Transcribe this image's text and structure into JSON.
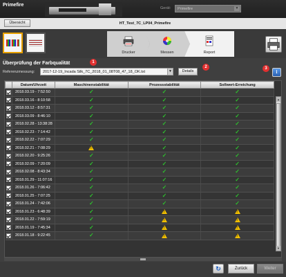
{
  "app": {
    "name": "Primefire"
  },
  "device": {
    "label": "Gerät:",
    "value": "Primefire"
  },
  "toolbar": {
    "overview_label": "Übersicht",
    "job_title": "HT_Test_7C_LP04_Primefire"
  },
  "steps": [
    {
      "label": "Drucker",
      "icon": "printer-icon"
    },
    {
      "label": "Messen",
      "icon": "color-wheel-icon"
    },
    {
      "label": "Report",
      "icon": "report-icon"
    }
  ],
  "section": {
    "title": "Überprüfung der Farbqualität"
  },
  "reference": {
    "label": "Referenzmessung:",
    "value": "2017-12-19_Incada Silk_7C_2018_01_08T08_47_18_OK.txt",
    "details_label": "Details"
  },
  "markers": [
    "1",
    "2",
    "3"
  ],
  "info_label": "i",
  "table": {
    "columns": [
      "",
      "Datum/Uhrzeit",
      "Maschinenstabilität",
      "Prozessstabilität",
      "Sollwert-Erreichung"
    ],
    "rows": [
      {
        "date": "2018.03.19 - 7:52:50",
        "m": "ok",
        "p": "ok",
        "s": "ok"
      },
      {
        "date": "2018.03.16 - 8:10:58",
        "m": "ok",
        "p": "ok",
        "s": "ok"
      },
      {
        "date": "2018.03.12 - 8:57:31",
        "m": "ok",
        "p": "ok",
        "s": "ok"
      },
      {
        "date": "2018.03.09 - 8:46:10",
        "m": "ok",
        "p": "ok",
        "s": "ok"
      },
      {
        "date": "2018.02.28 - 13:38:28",
        "m": "ok",
        "p": "ok",
        "s": "ok"
      },
      {
        "date": "2018.02.23 - 7:14:42",
        "m": "ok",
        "p": "ok",
        "s": "ok"
      },
      {
        "date": "2018.02.22 - 7:07:29",
        "m": "ok",
        "p": "ok",
        "s": "ok"
      },
      {
        "date": "2018.02.21 - 7:08:29",
        "m": "warn",
        "p": "ok",
        "s": "ok"
      },
      {
        "date": "2018.02.20 - 9:25:26",
        "m": "ok",
        "p": "ok",
        "s": "ok"
      },
      {
        "date": "2018.02.09 - 7:20:09",
        "m": "ok",
        "p": "ok",
        "s": "ok"
      },
      {
        "date": "2018.02.08 - 8:43:34",
        "m": "ok",
        "p": "ok",
        "s": "ok"
      },
      {
        "date": "2018.01.29 - 11:07:16",
        "m": "ok",
        "p": "ok",
        "s": "ok"
      },
      {
        "date": "2018.01.26 - 7:06:42",
        "m": "ok",
        "p": "ok",
        "s": "ok"
      },
      {
        "date": "2018.01.25 - 7:07:25",
        "m": "ok",
        "p": "ok",
        "s": "ok"
      },
      {
        "date": "2018.01.24 - 7:42:06",
        "m": "ok",
        "p": "ok",
        "s": "ok"
      },
      {
        "date": "2018.01.23 - 6:48:39",
        "m": "ok",
        "p": "warn",
        "s": "warn"
      },
      {
        "date": "2018.01.22 - 7:59:19",
        "m": "ok",
        "p": "warn",
        "s": "warn"
      },
      {
        "date": "2018.01.19 - 7:45:34",
        "m": "ok",
        "p": "warn",
        "s": "warn"
      },
      {
        "date": "2018.01.18 - 9:22:45",
        "m": "ok",
        "p": "warn",
        "s": "warn"
      }
    ]
  },
  "bottom": {
    "back_label": "Zurück",
    "next_label": "Weiter"
  },
  "colors": {
    "accent_selected": "#e8a000",
    "ok": "#2ec02e",
    "warn": "#f2c000",
    "marker": "#e23030"
  }
}
